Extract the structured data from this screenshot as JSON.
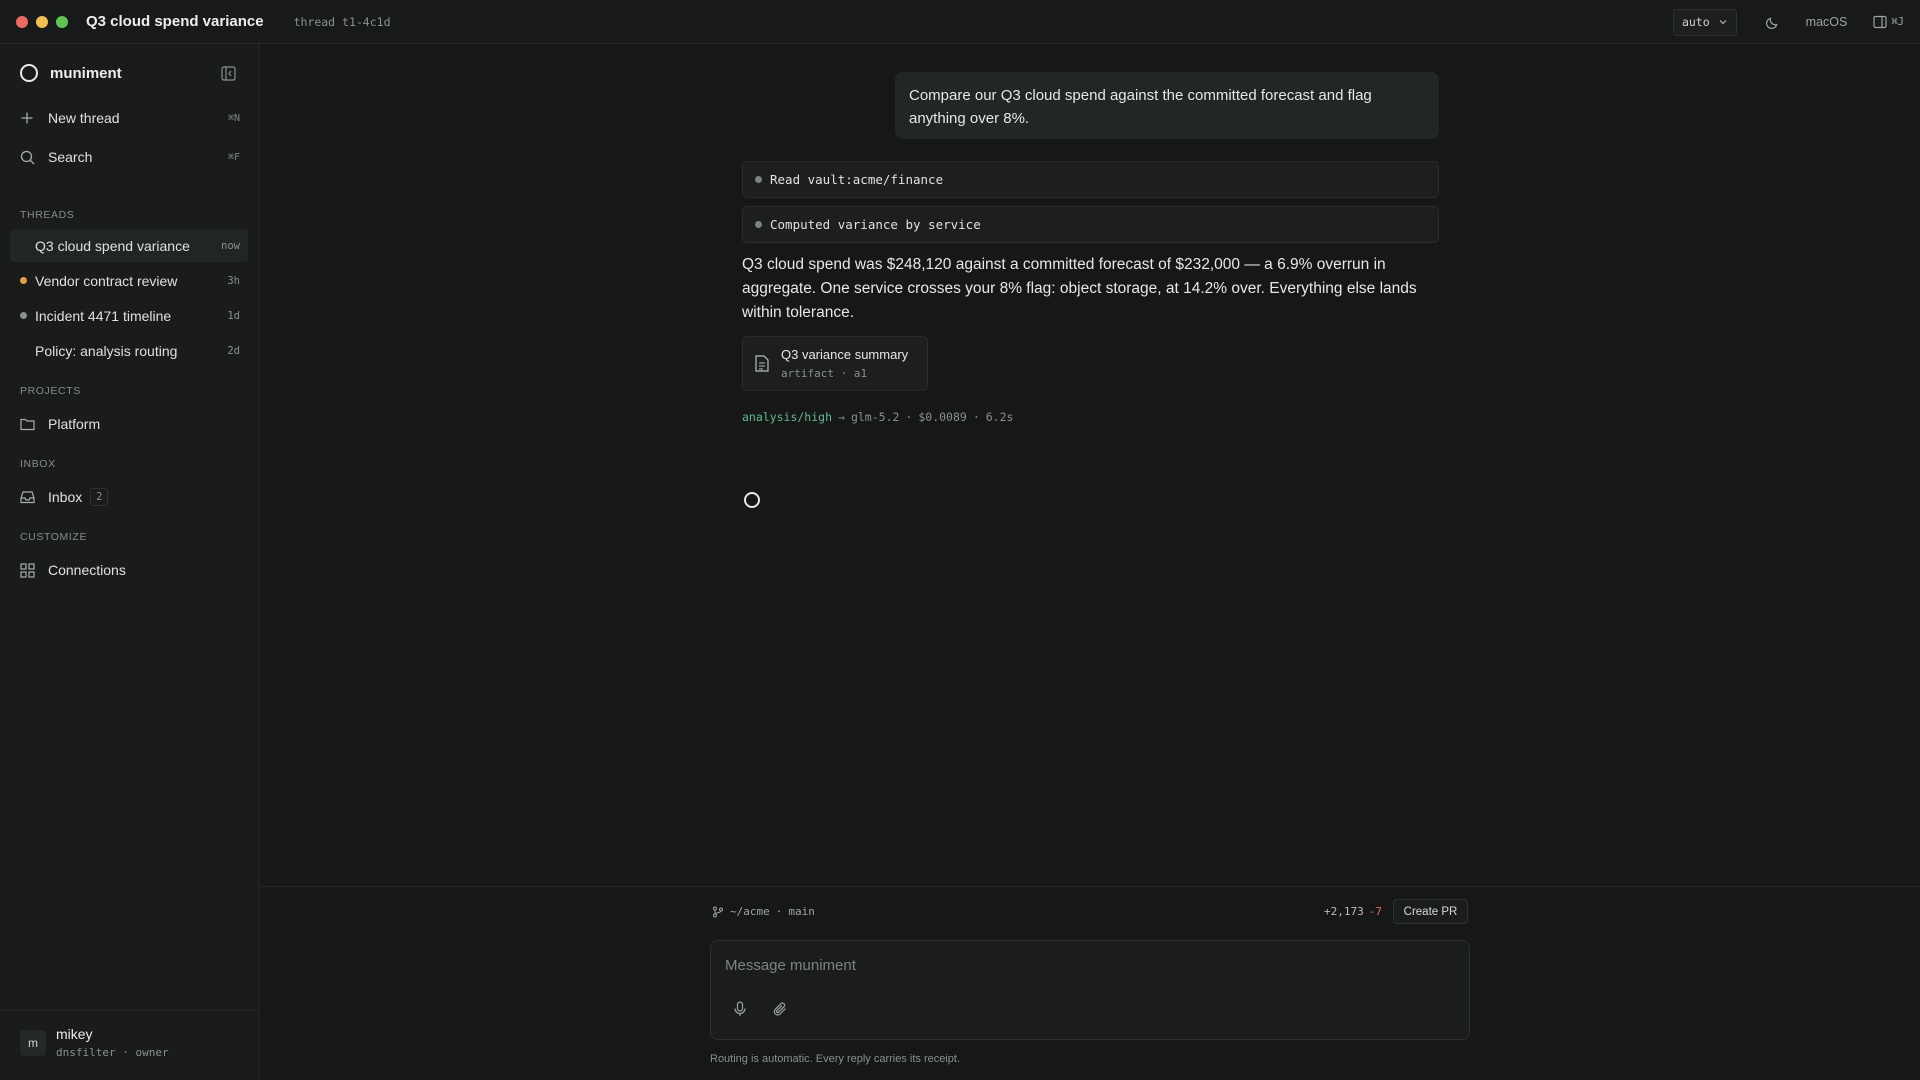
{
  "window": {
    "title": "Q3 cloud spend variance",
    "thread_id": "thread t1-4c1d",
    "mode": "auto",
    "platform": "macOS",
    "panel_shortcut": "⌘J"
  },
  "sidebar": {
    "brand": "muniment",
    "new_thread": {
      "label": "New thread",
      "shortcut": "⌘N"
    },
    "search": {
      "label": "Search",
      "shortcut": "⌘F"
    },
    "threads_label": "THREADS",
    "threads": [
      {
        "title": "Q3 cloud spend variance",
        "time": "now",
        "status": "none"
      },
      {
        "title": "Vendor contract review",
        "time": "3h",
        "status": "pending"
      },
      {
        "title": "Incident 4471 timeline",
        "time": "1d",
        "status": "idle"
      },
      {
        "title": "Policy: analysis routing",
        "time": "2d",
        "status": "none"
      }
    ],
    "projects_label": "PROJECTS",
    "projects": [
      {
        "label": "Platform"
      }
    ],
    "inbox_label": "INBOX",
    "inbox": {
      "label": "Inbox",
      "count": "2"
    },
    "customize_label": "CUSTOMIZE",
    "connections": {
      "label": "Connections"
    },
    "user": {
      "initial": "m",
      "name": "mikey",
      "org": "dnsfilter · owner"
    }
  },
  "conversation": {
    "user_message": "Compare our Q3 cloud spend against the committed forecast and flag anything over 8%.",
    "tool_steps": [
      {
        "label": "Read vault:acme/finance"
      },
      {
        "label": "Computed variance by service"
      }
    ],
    "answer": "Q3 cloud spend was $248,120 against a committed forecast of $232,000 — a 6.9% overrun in aggregate. One service crosses your 8% flag: object storage, at 14.2% over. Everything else lands within tolerance.",
    "artifact": {
      "title": "Q3 variance summary",
      "subtitle": "artifact · a1"
    },
    "receipt": {
      "route": "analysis/high",
      "arrow": "→",
      "model": "glm-5.2",
      "cost": "$0.0089",
      "duration": "6.2s",
      "sep": "·"
    }
  },
  "composer": {
    "repo": "~/acme",
    "branch": "main",
    "additions": "+2,173",
    "deletions": "-7",
    "create_pr": "Create PR",
    "placeholder": "Message muniment",
    "footnote": "Routing is automatic. Every reply carries its receipt."
  },
  "colors": {
    "accent_route": "#5fb98c",
    "status_pending": "#e8a23c",
    "status_idle": "#8a8f8f",
    "deletions": "#e0675f"
  }
}
